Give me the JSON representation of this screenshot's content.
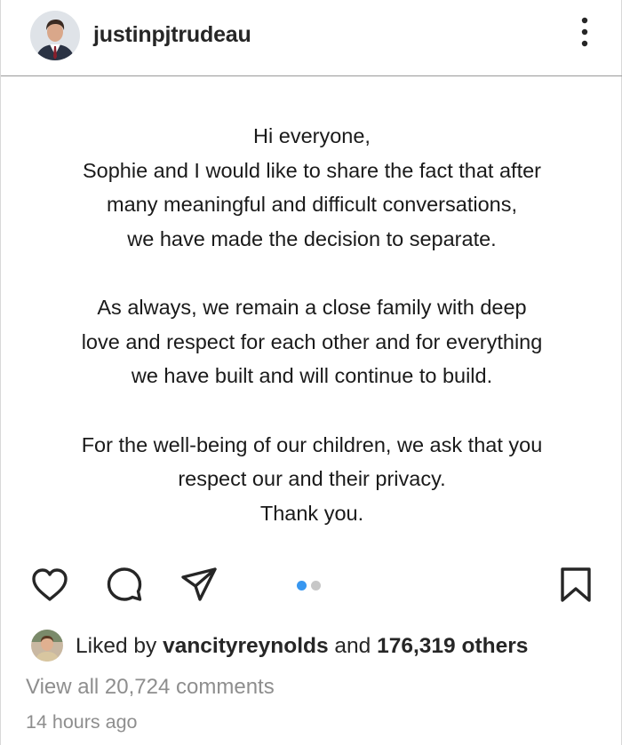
{
  "header": {
    "username": "justinpjtrudeau",
    "avatar_icon": "profile-avatar-icon",
    "more_icon": "more-options-icon"
  },
  "post": {
    "lines": [
      "Hi everyone,",
      "Sophie and I would like to share the fact that after",
      "many meaningful and difficult conversations,",
      "we have made the decision to separate.",
      "",
      "As always, we remain a close family with deep",
      "love and respect for each other and for everything",
      "we have built and will continue to build.",
      "",
      "For the well-being of our children, we ask that you",
      "respect our and their privacy.",
      "Thank you."
    ]
  },
  "actions": {
    "like_icon": "heart-icon",
    "comment_icon": "comment-icon",
    "share_icon": "share-icon",
    "save_icon": "bookmark-icon",
    "carousel": {
      "total": 2,
      "active": 1
    },
    "colors": {
      "active_dot": "#3897f0",
      "inactive_dot": "#c7c7c7"
    }
  },
  "likes": {
    "prefix": "Liked by ",
    "liker": "vancityreynolds",
    "middle": " and ",
    "others": "176,319 others"
  },
  "comments": {
    "view_all": "View all 20,724 comments"
  },
  "timestamp": "14 hours ago"
}
